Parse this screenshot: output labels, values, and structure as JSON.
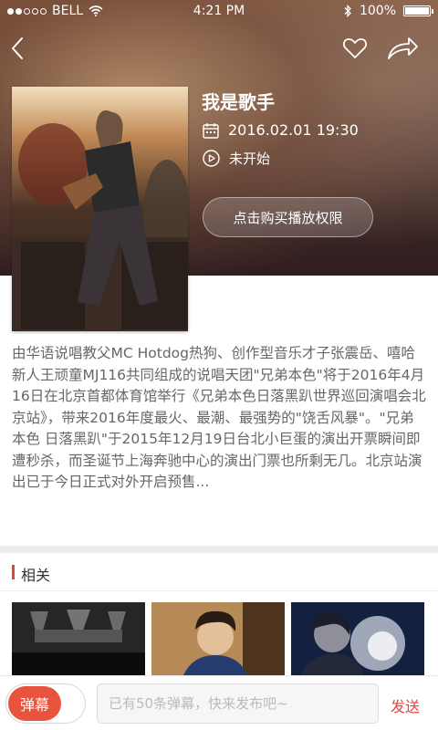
{
  "status_bar": {
    "carrier": "BELL",
    "time": "4:21 PM",
    "battery": "100%",
    "signal_bars_filled": 2,
    "signal_bars_total": 5
  },
  "nav": {
    "back_icon": "chevron-left-icon",
    "like_icon": "heart-icon",
    "share_icon": "share-icon"
  },
  "show": {
    "title": "我是歌手",
    "date": "2016.02.01 19:30",
    "status": "未开始",
    "buy_label": "点击购买播放权限"
  },
  "description": "由华语说唱教父MC Hotdog热狗、创作型音乐才子张震岳、嘻哈新人王顽童MJ116共同组成的说唱天团\"兄弟本色\"将于2016年4月16日在北京首都体育馆举行《兄弟本色日落黑趴世界巡回演唱会北京站》，带来2016年度最火、最潮、最强势的\"饶舌风暴\"。\"兄弟本色 日落黑趴\"于2015年12月19日台北小巨蛋的演出开票瞬间即遭秒杀，而圣诞节上海奔驰中心的演出门票也所剩无几。北京站演出已于今日正式对外开启预售...",
  "related": {
    "title": "相关",
    "items": [
      {
        "name": "concert-stage"
      },
      {
        "name": "singer-portrait"
      },
      {
        "name": "singer-spotlight"
      }
    ]
  },
  "bottom_bar": {
    "danmu_label": "弹幕",
    "input_placeholder": "已有50条弹幕，快来发布吧~",
    "input_value": "",
    "send_label": "发送"
  },
  "colors": {
    "accent": "#e5433b",
    "toggle": "#e8533d"
  }
}
